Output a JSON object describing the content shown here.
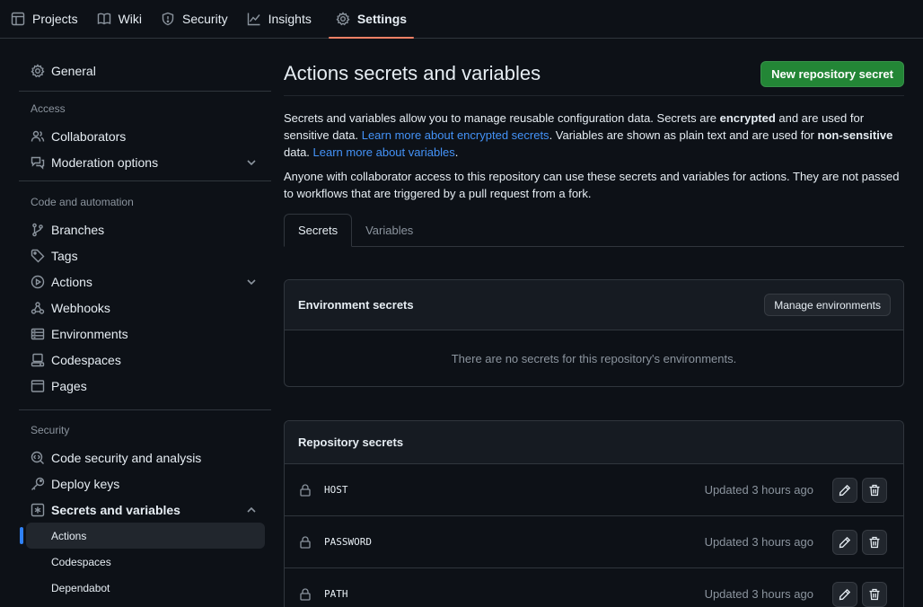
{
  "topnav": {
    "tabs": [
      {
        "label": "Projects",
        "icon": "table-icon"
      },
      {
        "label": "Wiki",
        "icon": "book-icon"
      },
      {
        "label": "Security",
        "icon": "shield-icon"
      },
      {
        "label": "Insights",
        "icon": "graph-icon"
      },
      {
        "label": "Settings",
        "icon": "gear-icon",
        "active": true
      }
    ]
  },
  "sidebar": {
    "general": "General",
    "access_heading": "Access",
    "collaborators": "Collaborators",
    "moderation": "Moderation options",
    "code_heading": "Code and automation",
    "branches": "Branches",
    "tags": "Tags",
    "actions": "Actions",
    "webhooks": "Webhooks",
    "environments": "Environments",
    "codespaces": "Codespaces",
    "pages": "Pages",
    "security_heading": "Security",
    "code_security": "Code security and analysis",
    "deploy_keys": "Deploy keys",
    "secrets_vars": "Secrets and variables",
    "sub_actions": "Actions",
    "sub_codespaces": "Codespaces",
    "sub_dependabot": "Dependabot"
  },
  "main": {
    "title": "Actions secrets and variables",
    "new_secret_button": "New repository secret",
    "p1": {
      "t1": "Secrets and variables allow you to manage reusable configuration data. Secrets are ",
      "b1": "encrypted",
      "t2": " and are used for sensitive data. ",
      "link1": "Learn more about encrypted secrets",
      "t3": ". Variables are shown as plain text and are used for ",
      "b2": "non-sensitive",
      "t4": " data. ",
      "link2": "Learn more about variables",
      "t5": "."
    },
    "p2": "Anyone with collaborator access to this repository can use these secrets and variables for actions. They are not passed to workflows that are triggered by a pull request from a fork.",
    "tabs": {
      "secrets": "Secrets",
      "variables": "Variables"
    },
    "env_secrets": {
      "title": "Environment secrets",
      "manage_button": "Manage environments",
      "empty": "There are no secrets for this repository's environments."
    },
    "repo_secrets": {
      "title": "Repository secrets",
      "rows": [
        {
          "name": "HOST",
          "updated": "Updated 3 hours ago"
        },
        {
          "name": "PASSWORD",
          "updated": "Updated 3 hours ago"
        },
        {
          "name": "PATH",
          "updated": "Updated 3 hours ago"
        }
      ]
    }
  },
  "colors": {
    "background": "#0d1117",
    "accent_tab": "#f78166",
    "primary_button": "#238636",
    "link": "#4493f8",
    "active_marker": "#2f81f7"
  }
}
